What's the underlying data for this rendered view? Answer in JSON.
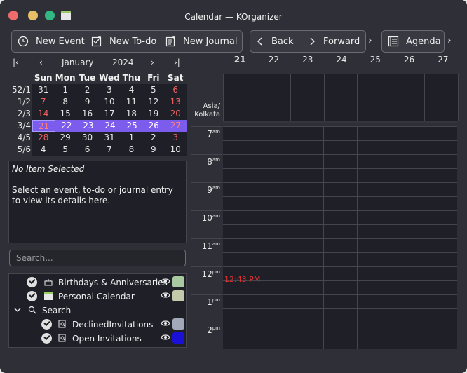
{
  "window": {
    "title": "Calendar — KOrganizer"
  },
  "toolbar": {
    "new_event": "New Event",
    "new_todo": "New To-do",
    "new_journal": "New Journal",
    "back": "Back",
    "forward": "Forward",
    "agenda": "Agenda"
  },
  "minical": {
    "month": "January",
    "year": "2024",
    "weekdays": [
      "Sun",
      "Mon",
      "Tue",
      "Wed",
      "Thu",
      "Fri",
      "Sat"
    ],
    "week_numbers": [
      "52/1",
      "1/2",
      "2/3",
      "3/4",
      "4/5",
      "5/6"
    ],
    "rows": [
      [
        "31",
        "1",
        "2",
        "3",
        "4",
        "5",
        "6"
      ],
      [
        "7",
        "8",
        "9",
        "10",
        "11",
        "12",
        "13"
      ],
      [
        "14",
        "15",
        "16",
        "17",
        "18",
        "19",
        "20"
      ],
      [
        "21",
        "22",
        "23",
        "24",
        "25",
        "26",
        "27"
      ],
      [
        "28",
        "29",
        "30",
        "31",
        "1",
        "2",
        "3"
      ],
      [
        "4",
        "5",
        "6",
        "7",
        "8",
        "9",
        "10"
      ]
    ]
  },
  "detail": {
    "title": "No Item Selected",
    "text": "Select an event, to-do or journal entry to view its details here."
  },
  "search": {
    "placeholder": "Search..."
  },
  "calendars": [
    {
      "label": "Birthdays & Anniversaries",
      "color": "#a9c9a1"
    },
    {
      "label": "Personal Calendar",
      "color": "#c4c9a9"
    },
    {
      "label": "Search"
    },
    {
      "label": "DeclinedInvitations",
      "color": "#a2a9b8"
    },
    {
      "label": "Open Invitations",
      "color": "#1b10d6"
    }
  ],
  "agenda": {
    "dates": [
      "21",
      "22",
      "23",
      "24",
      "25",
      "26",
      "27"
    ],
    "timezone": "Asia/ Kolkata",
    "hours": [
      {
        "h": "7",
        "s": "am"
      },
      {
        "h": "8",
        "s": "am"
      },
      {
        "h": "9",
        "s": "am"
      },
      {
        "h": "10",
        "s": "am"
      },
      {
        "h": "11",
        "s": "am"
      },
      {
        "h": "12",
        "s": "pm"
      },
      {
        "h": "1",
        "s": "pm"
      },
      {
        "h": "2",
        "s": "pm"
      }
    ],
    "now": "12:43 PM"
  }
}
